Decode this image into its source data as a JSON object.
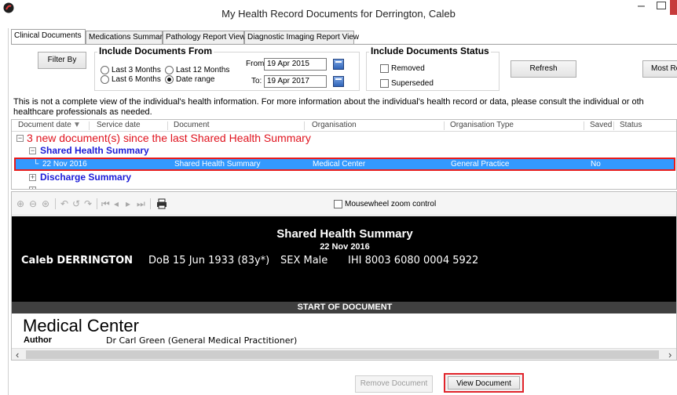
{
  "window": {
    "title": "My Health Record Documents for Derrington, Caleb",
    "minimize": "–"
  },
  "tabs": [
    {
      "label": "Clinical Documents",
      "active": true
    },
    {
      "label": "Medications Summary",
      "active": false
    },
    {
      "label": "Pathology Report View",
      "active": false
    },
    {
      "label": "Diagnostic Imaging Report View",
      "active": false
    }
  ],
  "filter": {
    "filter_by_label": "Filter By",
    "include_from_title": "Include Documents From",
    "radios": [
      {
        "label": "Last 3 Months",
        "checked": false
      },
      {
        "label": "Last 12 Months",
        "checked": false
      },
      {
        "label": "Last 6 Months",
        "checked": false
      },
      {
        "label": "Date range",
        "checked": true
      }
    ],
    "from_label": "From:",
    "from_value": "19 Apr 2015",
    "to_label": "To:",
    "to_value": "19 Apr 2017",
    "status_title": "Include Documents Status",
    "status_checks": [
      {
        "label": "Removed",
        "checked": false
      },
      {
        "label": "Superseded",
        "checked": false
      }
    ],
    "refresh_label": "Refresh",
    "most_recent_label": "Most Re"
  },
  "notice": "This is not a complete view of the individual's health information. For more information about the individual's health record or data, please consult the individual or oth healthcare professionals as needed.",
  "grid": {
    "columns": [
      "Document date",
      "Service date",
      "Document",
      "Organisation",
      "Organisation Type",
      "Saved",
      "Status"
    ],
    "new_docs_text": "3 new document(s) since the last Shared Health Summary",
    "groups": [
      {
        "label": "Shared Health Summary",
        "expander": "⊟"
      },
      {
        "label": "Discharge Summary",
        "expander": "⊞"
      }
    ],
    "selected_row": {
      "document_date": "22 Nov 2016",
      "service_date": "",
      "document": "Shared Health Summary",
      "organisation": "Medical Center",
      "organisation_type": "General Practice",
      "saved": "No",
      "status": ""
    }
  },
  "viewer": {
    "mousewheel_label": "Mousewheel zoom control",
    "doc_title": "Shared Health Summary",
    "doc_date": "22 Nov 2016",
    "patient_name": "Caleb DERRINGTON",
    "dob": "DoB 15 Jun 1933 (83y*)",
    "sex": "SEX Male",
    "ihi": "IHI 8003 6080 0004 5922",
    "start_of_document": "START OF DOCUMENT",
    "organisation": "Medical Center",
    "author_label": "Author",
    "author_value": "Dr Carl Green (General Medical Practitioner)"
  },
  "buttons": {
    "remove": "Remove Document",
    "view": "View Document"
  },
  "colors": {
    "selection": "#3399ff",
    "highlight_border": "#e81b1b",
    "new_docs": "#e0131e",
    "group_label": "#1b1bd8"
  }
}
